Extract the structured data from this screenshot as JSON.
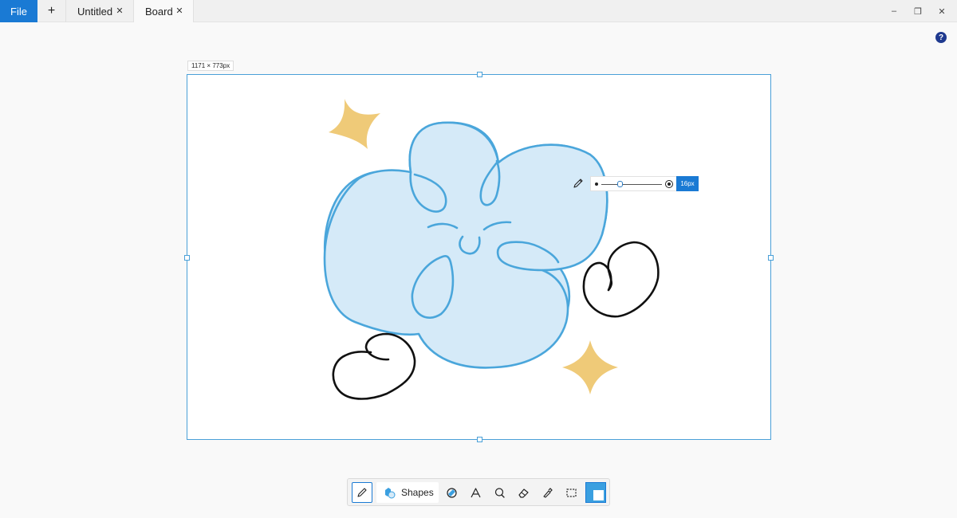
{
  "titlebar": {
    "file_label": "File",
    "new_tab_icon": "plus-icon",
    "tabs": [
      {
        "label": "Untitled",
        "close_icon": "close-icon"
      },
      {
        "label": "Board",
        "close_icon": "close-icon",
        "active": true
      }
    ],
    "window_controls": [
      "minimize-icon",
      "restore-icon",
      "close-icon"
    ],
    "minimize_glyph": "–",
    "restore_glyph": "❐",
    "close_glyph": "✕",
    "tab_close_glyph": "✕",
    "plus_glyph": "+"
  },
  "help": {
    "glyph": "?",
    "icon": "help-icon"
  },
  "canvas": {
    "size_label": "1171 × 773px",
    "background": "#ffffff",
    "border_color": "#4aa0d8"
  },
  "brush": {
    "size_label": "16px",
    "slider_level": 0.3,
    "accent": "#1a7ad4"
  },
  "drawing": {
    "colors": {
      "blue_stroke": "#4aa6db",
      "blue_fill": "#d5eaf8",
      "star_fill": "#efca78",
      "black_stroke": "#111111"
    }
  },
  "toolbar": {
    "tools": [
      "pencil-icon",
      "shapes-icon",
      "fill-icon",
      "text-icon",
      "lasso-icon",
      "eraser-icon",
      "eyedropper-icon",
      "select-icon"
    ],
    "shapes_label": "Shapes",
    "active_tool": "pencil",
    "active_color": "#3a9fe0"
  }
}
